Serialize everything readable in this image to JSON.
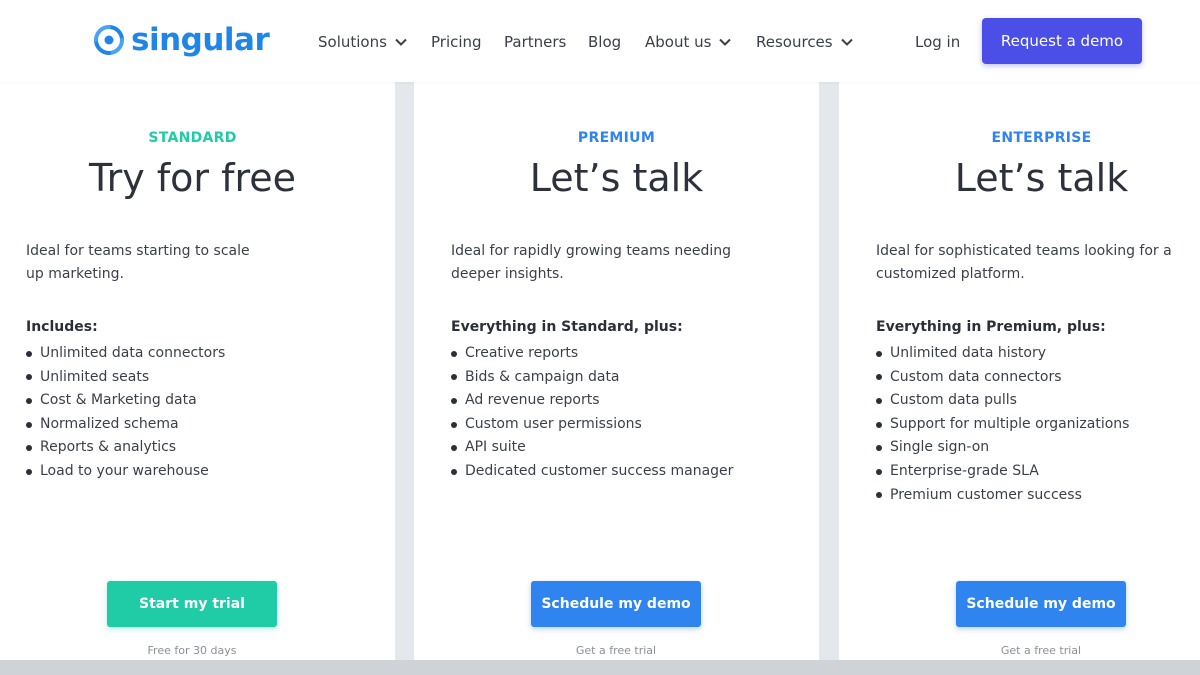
{
  "header": {
    "logo_text": "singular",
    "nav": [
      {
        "label": "Solutions",
        "has_dropdown": true
      },
      {
        "label": "Pricing",
        "has_dropdown": false
      },
      {
        "label": "Partners",
        "has_dropdown": false
      },
      {
        "label": "Blog",
        "has_dropdown": false
      },
      {
        "label": "About us",
        "has_dropdown": true
      },
      {
        "label": "Resources",
        "has_dropdown": true
      }
    ],
    "login_label": "Log in",
    "cta_label": "Request a demo"
  },
  "colors": {
    "brand_blue": "#1f86e8",
    "cta_purple": "#4b4fe8",
    "standard_green": "#1fcca6",
    "premium_blue": "#2f84f0"
  },
  "plans": [
    {
      "tier": "STANDARD",
      "headline": "Try for free",
      "description_lines": [
        "Ideal for teams starting to scale",
        "up marketing."
      ],
      "includes_title": "Includes:",
      "features": [
        "Unlimited data connectors",
        "Unlimited seats",
        "Cost & Marketing data",
        "Normalized schema",
        "Reports & analytics",
        "Load to your warehouse"
      ],
      "button_label": "Start my trial",
      "note": "Free for 30 days"
    },
    {
      "tier": "PREMIUM",
      "headline": "Let’s talk",
      "description_lines": [
        "Ideal for rapidly growing teams needing",
        "deeper insights."
      ],
      "includes_title": "Everything in Standard, plus:",
      "features": [
        "Creative reports",
        "Bids & campaign data",
        "Ad revenue reports",
        "Custom user permissions",
        "API suite",
        "Dedicated customer success manager"
      ],
      "button_label": "Schedule my demo",
      "note": "Get a free trial"
    },
    {
      "tier": "ENTERPRISE",
      "headline": "Let’s talk",
      "description_lines": [
        "Ideal for sophisticated teams looking for a",
        "customized platform."
      ],
      "includes_title": "Everything in Premium, plus:",
      "features": [
        "Unlimited data history",
        "Custom data connectors",
        "Custom data pulls",
        "Support for multiple organizations",
        "Single sign-on",
        "Enterprise-grade SLA",
        "Premium customer success"
      ],
      "button_label": "Schedule my demo",
      "note": "Get a free trial"
    }
  ]
}
